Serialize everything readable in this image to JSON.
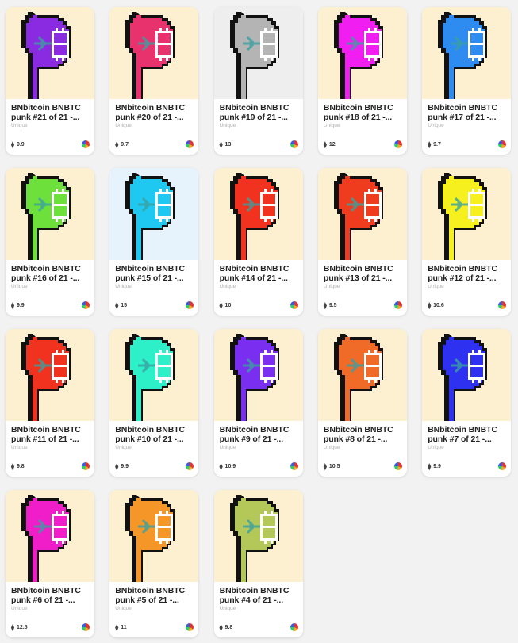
{
  "collection_label": "Unique",
  "chain_icon": "multicolor-chain-icon",
  "currency_icon": "ethereum-icon",
  "cards": [
    {
      "title": "BNbitcoin BNBTC punk #21 of 21 -...",
      "price": "9.9",
      "color": "#8a2be2",
      "bg": "#fdf0d0"
    },
    {
      "title": "BNbitcoin BNBTC punk #20 of 21 -...",
      "price": "9.7",
      "color": "#e8326e",
      "bg": "#fdf0d0"
    },
    {
      "title": "BNbitcoin BNBTC punk #19 of 21 -...",
      "price": "13",
      "color": "#b4b4b4",
      "bg": "#eeeeee"
    },
    {
      "title": "BNbitcoin BNBTC punk #18 of 21 -...",
      "price": "12",
      "color": "#f01ef0",
      "bg": "#fdf0d0"
    },
    {
      "title": "BNbitcoin BNBTC punk #17 of 21 -...",
      "price": "9.7",
      "color": "#2e8cf0",
      "bg": "#fdf0d0"
    },
    {
      "title": "BNbitcoin BNBTC punk #16 of 21 -...",
      "price": "9.9",
      "color": "#6ee03c",
      "bg": "#fdf0d0"
    },
    {
      "title": "BNbitcoin BNBTC punk #15 of 21 -...",
      "price": "15",
      "color": "#1ec8f0",
      "bg": "#e6f2fc"
    },
    {
      "title": "BNbitcoin BNBTC punk #14 of 21 -...",
      "price": "10",
      "color": "#f0321e",
      "bg": "#fdf0d0"
    },
    {
      "title": "BNbitcoin BNBTC punk #13 of 21 -...",
      "price": "9.5",
      "color": "#f03c1e",
      "bg": "#fdf0d0"
    },
    {
      "title": "BNbitcoin BNBTC punk #12 of 21 -...",
      "price": "10.6",
      "color": "#f5f01e",
      "bg": "#fdf0d0"
    },
    {
      "title": "BNbitcoin BNBTC punk #11 of 21 -...",
      "price": "9.8",
      "color": "#f0321e",
      "bg": "#fdf0d0"
    },
    {
      "title": "BNbitcoin BNBTC punk #10 of 21 -...",
      "price": "9.9",
      "color": "#2ef0c8",
      "bg": "#fdf0d0"
    },
    {
      "title": "BNbitcoin BNBTC punk #9 of 21 -...",
      "price": "10.9",
      "color": "#7a2ef0",
      "bg": "#fdf0d0"
    },
    {
      "title": "BNbitcoin BNBTC punk #8 of 21 -...",
      "price": "10.5",
      "color": "#f06a28",
      "bg": "#fdf0d0"
    },
    {
      "title": "BNbitcoin BNBTC punk #7 of 21 -...",
      "price": "9.9",
      "color": "#2e32f0",
      "bg": "#fdf0d0"
    },
    {
      "title": "BNbitcoin BNBTC punk #6 of 21 -...",
      "price": "12.5",
      "color": "#f01ec8",
      "bg": "#fdf0d0"
    },
    {
      "title": "BNbitcoin BNBTC punk #5 of 21 -...",
      "price": "11",
      "color": "#f59628",
      "bg": "#fdf0d0"
    },
    {
      "title": "BNbitcoin BNBTC punk #4 of 21 -...",
      "price": "9.8",
      "color": "#b4c85a",
      "bg": "#fdf0d0"
    }
  ]
}
